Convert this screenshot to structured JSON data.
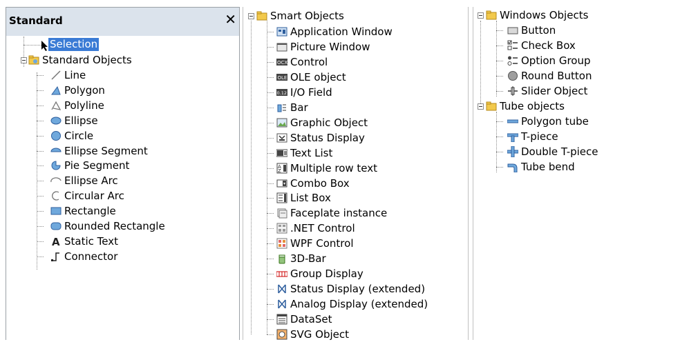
{
  "panel": {
    "title": "Standard",
    "close": "✕"
  },
  "standard_tree": {
    "selection": "Selection",
    "group": "Standard Objects",
    "items": [
      "Line",
      "Polygon",
      "Polyline",
      "Ellipse",
      "Circle",
      "Ellipse Segment",
      "Pie Segment",
      "Ellipse Arc",
      "Circular Arc",
      "Rectangle",
      "Rounded Rectangle",
      "Static Text",
      "Connector"
    ]
  },
  "smart_tree": {
    "group": "Smart Objects",
    "items": [
      "Application Window",
      "Picture Window",
      "Control",
      "OLE object",
      "I/O Field",
      "Bar",
      "Graphic Object",
      "Status Display",
      "Text List",
      "Multiple row text",
      "Combo Box",
      "List Box",
      "Faceplate instance",
      ".NET Control",
      "WPF Control",
      "3D-Bar",
      "Group Display",
      "Status Display (extended)",
      "Analog Display (extended)",
      "DataSet",
      "SVG Object"
    ],
    "icon_texts": [
      "OCX",
      "OLE",
      "0.12"
    ]
  },
  "windows_tree": {
    "group": "Windows Objects",
    "items": [
      "Button",
      "Check Box",
      "Option Group",
      "Round Button",
      "Slider Object"
    ]
  },
  "tube_tree": {
    "group": "Tube objects",
    "items": [
      "Polygon tube",
      "T-piece",
      "Double T-piece",
      "Tube bend"
    ]
  },
  "colors": {
    "selection": "#3a7bd5",
    "title_bar": "#dbe3ec",
    "folder": "#f2c94c",
    "shape_blue": "#6fa8dc"
  }
}
